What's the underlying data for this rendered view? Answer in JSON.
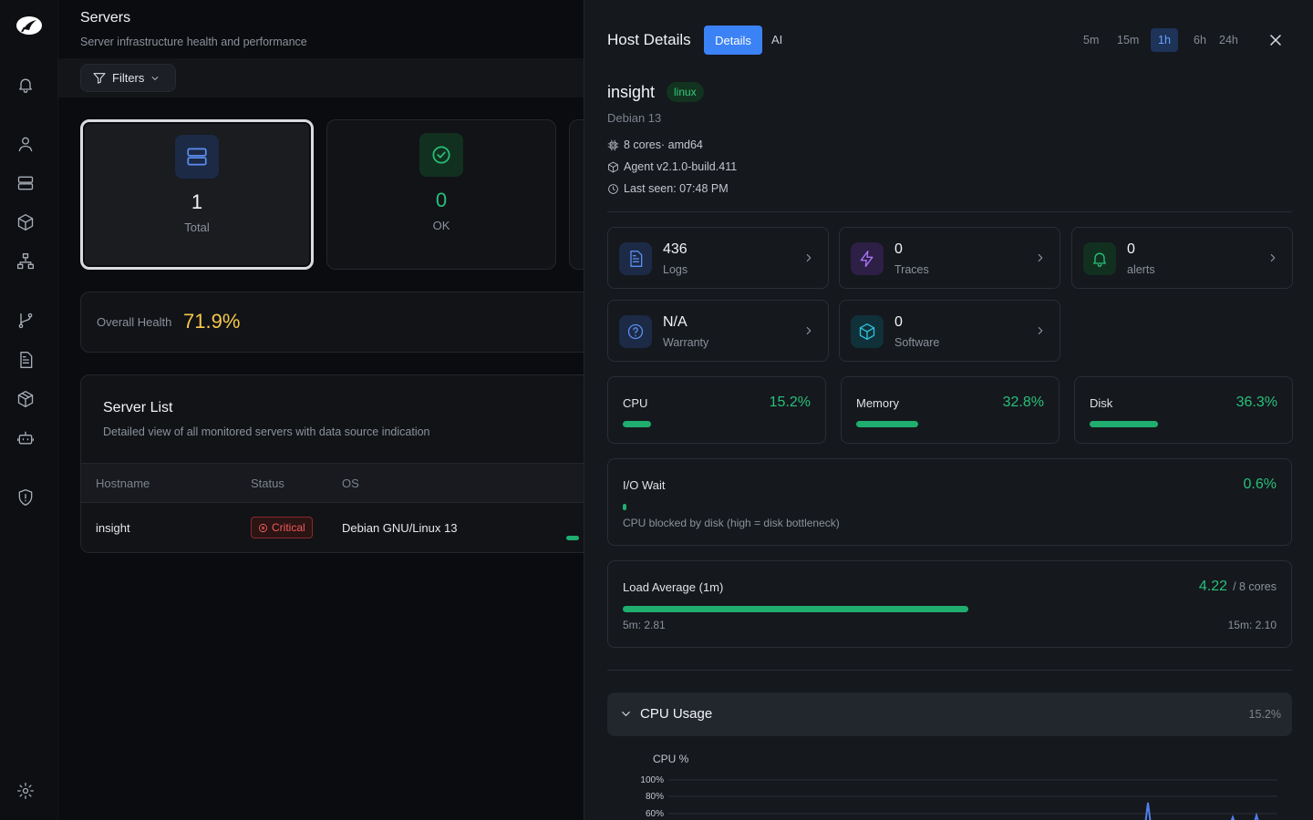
{
  "page": {
    "title": "Servers",
    "subtitle": "Server infrastructure health and performance",
    "filters_label": "Filters"
  },
  "stats": [
    {
      "value": "1",
      "label": "Total"
    },
    {
      "value": "0",
      "label": "OK"
    }
  ],
  "health": {
    "label": "Overall Health",
    "value": "71.9%"
  },
  "server_list": {
    "title": "Server List",
    "subtitle": "Detailed view of all monitored servers with data source indication",
    "columns": [
      "Hostname",
      "Status",
      "OS"
    ],
    "rows": [
      {
        "hostname": "insight",
        "status": "Critical",
        "os": "Debian GNU/Linux 13"
      }
    ]
  },
  "drawer": {
    "title": "Host Details",
    "tabs": [
      "Details",
      "AI"
    ],
    "active_tab": "Details",
    "time_ranges": [
      "5m",
      "15m",
      "1h",
      "6h",
      "24h"
    ],
    "active_range": "1h",
    "host": {
      "name": "insight",
      "os_badge": "linux",
      "os": "Debian 13",
      "cores": "8 cores· amd64",
      "agent": "Agent v2.1.0-build.411",
      "last_seen": "Last seen: 07:48 PM"
    },
    "nav_cards": [
      {
        "value": "436",
        "label": "Logs",
        "icon": "file-text-icon"
      },
      {
        "value": "0",
        "label": "Traces",
        "icon": "lightning-icon"
      },
      {
        "value": "0",
        "label": "alerts",
        "icon": "bell-icon"
      },
      {
        "value": "N/A",
        "label": "Warranty",
        "icon": "question-icon"
      },
      {
        "value": "0",
        "label": "Software",
        "icon": "package-icon"
      }
    ],
    "metrics": [
      {
        "label": "CPU",
        "value": "15.2%",
        "fill": 0.152
      },
      {
        "label": "Memory",
        "value": "32.8%",
        "fill": 0.328
      },
      {
        "label": "Disk",
        "value": "36.3%",
        "fill": 0.363
      }
    ],
    "io_wait": {
      "label": "I/O Wait",
      "value": "0.6%",
      "fill": 0.006,
      "description": "CPU blocked by disk (high = disk bottleneck)"
    },
    "load_avg": {
      "label": "Load Average (1m)",
      "value": "4.22",
      "cores_suffix": "/ 8 cores",
      "fill": 0.5275,
      "five_min": "5m: 2.81",
      "fifteen_min": "15m: 2.10"
    },
    "cpu_section": {
      "title": "CPU Usage",
      "value": "15.2%",
      "chart_title": "CPU %",
      "y_ticks": [
        "100%",
        "80%",
        "60%"
      ]
    }
  },
  "colors": {
    "accent": "#3b82f6",
    "ok": "#27c07a",
    "warning": "#f5c84b",
    "critical": "#f05a5a"
  }
}
